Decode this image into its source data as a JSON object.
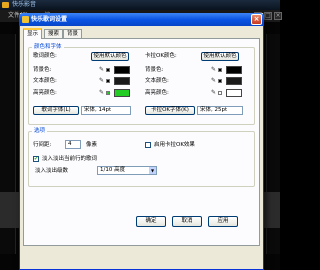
{
  "app": {
    "title": "快乐影音",
    "menu": [
      "文件(F)",
      "编"
    ],
    "window_buttons": [
      "_",
      "□",
      "×"
    ]
  },
  "dialog": {
    "title": "快乐歌词设置",
    "close": "×",
    "tabs": [
      {
        "label": "显示",
        "active": true
      },
      {
        "label": "搜索",
        "active": false
      },
      {
        "label": "背景",
        "active": false
      }
    ],
    "color_group": {
      "title": "颜色和字体",
      "left_col_title": "歌词颜色:",
      "right_col_title": "卡拉OK颜色:",
      "system_color_button": "使用默认颜色",
      "left_rows": [
        {
          "label": "背景色:",
          "color": "#000000"
        },
        {
          "label": "文本颜色:",
          "color": "#1a1a1a"
        },
        {
          "label": "高亮颜色:",
          "color": "#22cc22"
        }
      ],
      "right_rows": [
        {
          "label": "背景色:",
          "color": "#000000"
        },
        {
          "label": "文本颜色:",
          "color": "#1a1a1a"
        },
        {
          "label": "高亮颜色:",
          "color": "#ffffff"
        }
      ],
      "lyric_font_button": "歌词字体(L)",
      "lyric_font_value": "宋体, 14pt",
      "karaoke_font_button": "卡拉OK字体(K)",
      "karaoke_font_value": "宋体, 25pt"
    },
    "options_group": {
      "title": "选项",
      "line_spacing_label": "行间距:",
      "line_spacing_value": "4",
      "line_spacing_unit": "像素",
      "karaoke_effect_label": "启用卡拉OK效果",
      "karaoke_effect_checked": false,
      "fade_label": "淡入淡出当前行的歌词",
      "fade_checked": true,
      "fade_speed_label": "淡入淡出级数",
      "fade_speed_value": "1/10 高度"
    },
    "ok_button": "确定",
    "cancel_button": "取消",
    "apply_button": "应用"
  }
}
